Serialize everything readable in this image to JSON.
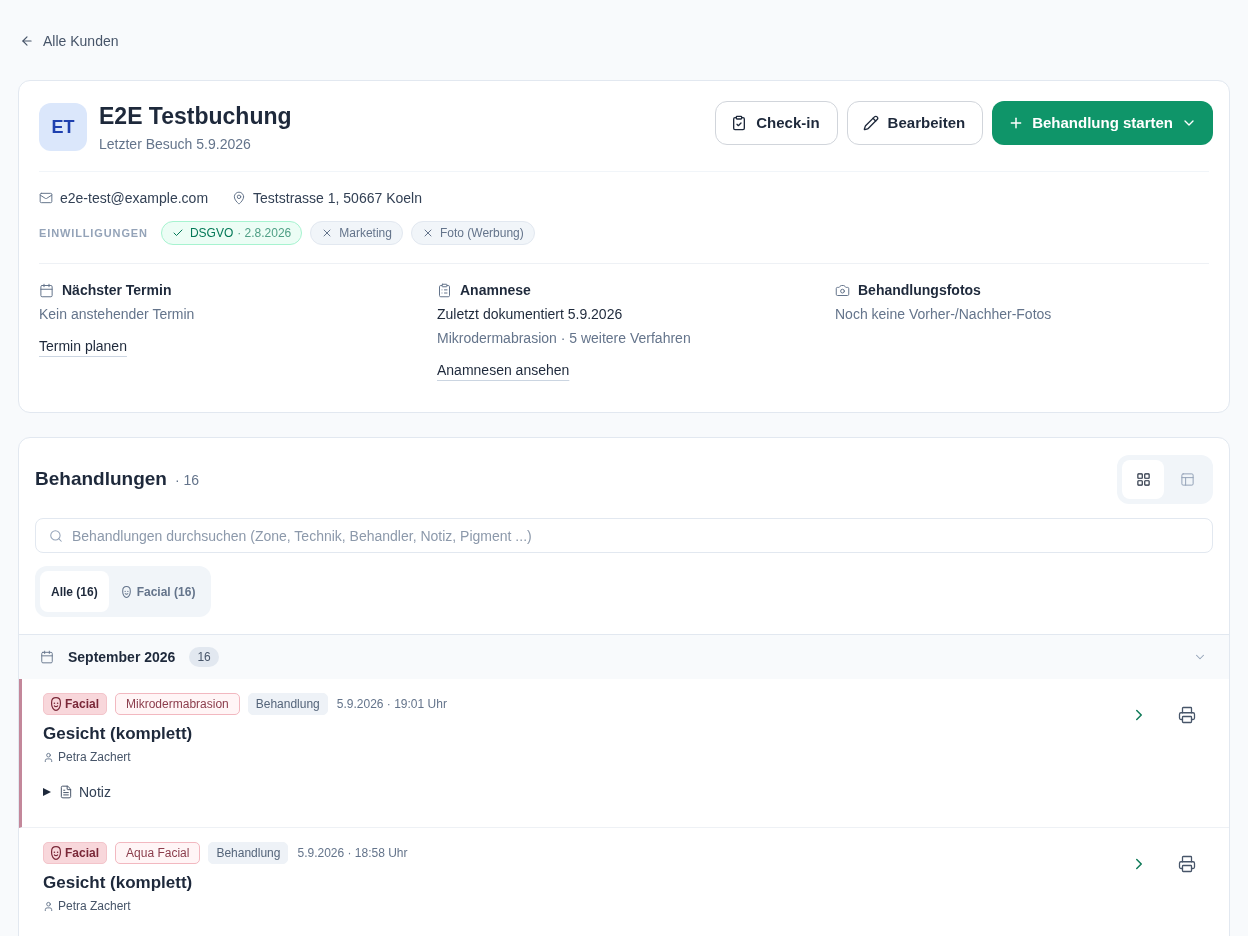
{
  "back_link": {
    "label": "Alle Kunden"
  },
  "customer": {
    "initials": "ET",
    "name": "E2E Testbuchung",
    "last_visit": "Letzter Besuch 5.9.2026",
    "email": "e2e-test@example.com",
    "address": "Teststrasse 1, 50667 Koeln"
  },
  "actions": [
    {
      "kind": "checkin",
      "label": "Check-in"
    },
    {
      "kind": "edit",
      "label": "Bearbeiten"
    },
    {
      "kind": "primary",
      "label": "Behandlung starten"
    }
  ],
  "consents": {
    "label": "EINWILLIGUNGEN",
    "items": [
      {
        "label": "DSGVO",
        "date": "· 2.8.2026",
        "granted": true
      },
      {
        "label": "Marketing",
        "granted": false
      },
      {
        "label": "Foto (Werbung)",
        "granted": false
      }
    ]
  },
  "info_columns": [
    {
      "kind": "calendar",
      "title": "Nächster Termin",
      "lines": [
        {
          "text": "Kein anstehender Termin",
          "muted": true
        }
      ],
      "link": "Termin planen"
    },
    {
      "kind": "clipboard",
      "title": "Anamnese",
      "lines": [
        {
          "text": "Zuletzt dokumentiert 5.9.2026",
          "muted": false
        },
        {
          "text": "Mikrodermabrasion · 5 weitere Verfahren",
          "muted": true
        }
      ],
      "link": "Anamnesen ansehen"
    },
    {
      "kind": "camera",
      "title": "Behandlungsfotos",
      "lines": [
        {
          "text": "Noch keine Vorher-/Nachher-Fotos",
          "muted": true
        }
      ]
    }
  ],
  "treatments": {
    "title": "Behandlungen",
    "count": "· 16",
    "view_modes": [
      {
        "kind": "grid",
        "selected": true
      },
      {
        "kind": "table",
        "selected": false
      }
    ],
    "search": {
      "placeholder": "Behandlungen durchsuchen (Zone, Technik, Behandler, Notiz, Pigment ...)"
    },
    "filters": [
      {
        "kind": "all",
        "label": "Alle (16)",
        "selected": true
      },
      {
        "kind": "facial",
        "label": "Facial (16)",
        "selected": false
      }
    ],
    "groups": [
      {
        "title": "September 2026",
        "count": "16",
        "expanded": true,
        "items": [
          {
            "highlighted": true,
            "tags": [
              {
                "kind": "category",
                "label": "Facial"
              },
              {
                "kind": "technique",
                "label": "Mikrodermabrasion"
              },
              {
                "kind": "type",
                "label": "Behandlung"
              }
            ],
            "datetime": "5.9.2026 · 19:01 Uhr",
            "title": "Gesicht (komplett)",
            "practitioner": "Petra Zachert",
            "note": {
              "label": "Notiz",
              "expanded": false
            }
          },
          {
            "highlighted": false,
            "tags": [
              {
                "kind": "category",
                "label": "Facial"
              },
              {
                "kind": "technique",
                "label": "Aqua Facial"
              },
              {
                "kind": "type",
                "label": "Behandlung"
              }
            ],
            "datetime": "5.9.2026 · 18:58 Uhr",
            "title": "Gesicht (komplett)",
            "practitioner": "Petra Zachert"
          }
        ]
      }
    ]
  }
}
